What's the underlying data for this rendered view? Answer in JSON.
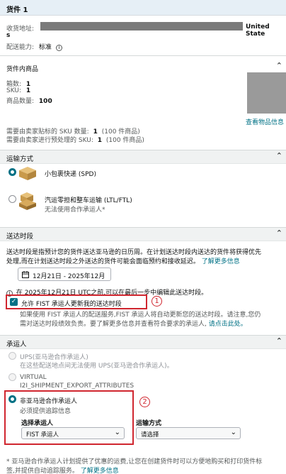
{
  "shipment": {
    "title": "货件 1",
    "address_label": "收货地址:",
    "address_country": "United State",
    "address_wrap": "s",
    "capability_label": "配送能力:",
    "capability_value": "标准"
  },
  "items": {
    "title": "货件内商品",
    "boxes_label": "箱数:",
    "boxes_value": "1",
    "sku_label": "SKU:",
    "sku_value": "1",
    "qty_label": "商品数量:",
    "qty_value": "100",
    "view_link": "查看物品信息",
    "label_line_prefix": "需要由卖家贴标的 SKU 数量:",
    "label_line_count": "1",
    "label_line_suffix": "(100 件商品)",
    "prep_line_prefix": "需要由卖家进行预处理的 SKU:",
    "prep_line_count": "1",
    "prep_line_suffix": "(100 件商品)"
  },
  "shipping_method": {
    "title": "运输方式",
    "spd_label": "小包裹快递 (SPD)",
    "ltl_label": "汽运零担和整车运输 (LTL/FTL)",
    "ltl_note": "无法使用合作承运人*"
  },
  "delivery": {
    "title": "送达时段",
    "desc_line1": "送达时段是指预计您的货件送达亚马逊的日历周。在计划送达时段内送达的货件将获得优先",
    "desc_line2": "处理,而在计划送达时段之外送达的货件可能会面临预约和接收延迟。",
    "learn_more": "了解更多信息",
    "date_range": "12月21日 - 2025年12月",
    "notice": "在 2025年12月21日 UTC之前,可以在最后一步中编辑此送达时段。",
    "allow_label": "允许 FIST 承运人更新我的送达时段",
    "fist_line1": "如果使用 FIST 承运人的配送服务,FIST 承运人将自动更新您的送达时段。请注意,您仍",
    "fist_line2_a": "需对送达时段绩效负责。要了解更多信息并查看符合要求的承运人,",
    "fist_line2_link": "请点击此处。",
    "callout1": "1"
  },
  "carrier": {
    "title": "承运人",
    "ups_label": "UPS(亚马逊合作承运人)",
    "ups_note": "在这些配送地点间无法使用 UPS(亚马逊合作承运人)。",
    "virtual_label": "VIRTUAL",
    "virtual_note": "I2I_SHIPMENT_EXPORT_ATTRIBUTES",
    "non_amazon_label": "非亚马逊合作承运人",
    "tracking_note": "必须提供追踪信息",
    "select_carrier_label": "选择承运人",
    "carrier_value": "FIST 承运人",
    "transport_label": "运输方式",
    "transport_value": "请选择",
    "callout2": "2"
  },
  "footer": {
    "line1": "* 亚马逊合作承运人计划提供了优惠的运费,让您在创建货件时可以方便地购买和打印货件标",
    "line2_a": "签,并提供自动追踪服务。",
    "line2_link": "了解更多信息"
  },
  "colors": {
    "link": "#007185",
    "callout": "#d0262f",
    "section_bg": "#f0f2f2"
  }
}
